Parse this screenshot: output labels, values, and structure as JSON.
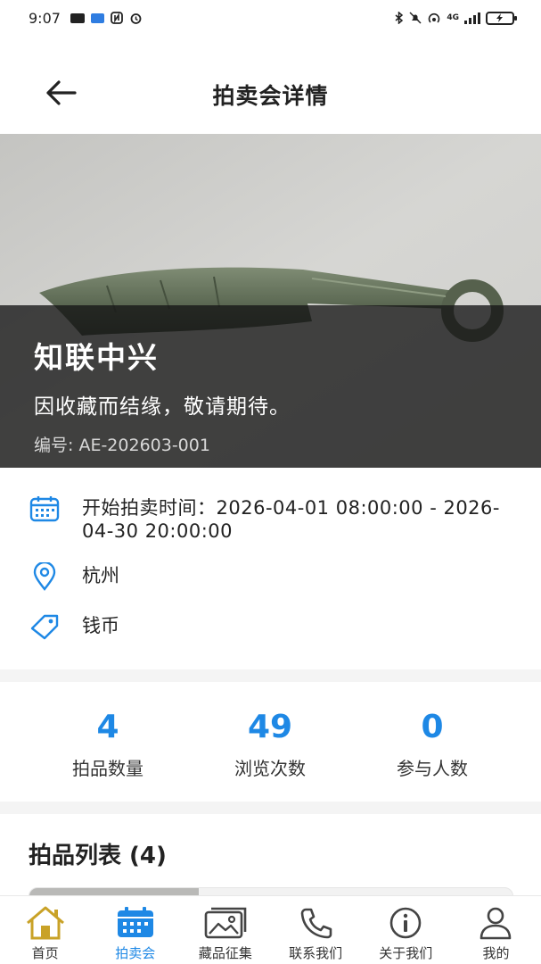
{
  "status_bar": {
    "time": "9:07",
    "network": "4G"
  },
  "header": {
    "title": "拍卖会详情"
  },
  "auction": {
    "title": "知联中兴",
    "subtitle": "因收藏而结缘，敬请期待。",
    "code": "编号: AE-202603-001",
    "time_label": "开始拍卖时间：2026-04-01 08:00:00 - 2026-04-30 20:00:00",
    "location": "杭州",
    "category": "钱币"
  },
  "stats": [
    {
      "value": "4",
      "label": "拍品数量"
    },
    {
      "value": "49",
      "label": "浏览次数"
    },
    {
      "value": "0",
      "label": "参与人数"
    }
  ],
  "list": {
    "title": "拍品列表 (4)"
  },
  "tabs": [
    {
      "label": "首页",
      "icon": "home-icon"
    },
    {
      "label": "拍卖会",
      "icon": "calendar-icon",
      "active": true
    },
    {
      "label": "藏品征集",
      "icon": "image-icon"
    },
    {
      "label": "联系我们",
      "icon": "phone-icon"
    },
    {
      "label": "关于我们",
      "icon": "info-icon"
    },
    {
      "label": "我的",
      "icon": "user-icon"
    }
  ],
  "colors": {
    "accent": "#1e88e5",
    "home_icon": "#c9a227"
  }
}
